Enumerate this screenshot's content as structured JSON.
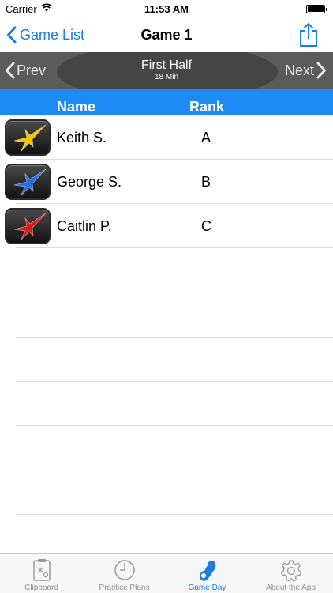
{
  "status_bar": {
    "carrier": "Carrier",
    "time": "11:53 AM"
  },
  "nav": {
    "back_label": "Game List",
    "title": "Game 1"
  },
  "period": {
    "prev_label": "Prev",
    "next_label": "Next",
    "title": "First Half",
    "duration": "18 Min"
  },
  "header": {
    "name_label": "Name",
    "rank_label": "Rank"
  },
  "players": [
    {
      "name": "Keith S.",
      "rank": "A",
      "star_color": "#f5c400"
    },
    {
      "name": "George S.",
      "rank": "B",
      "star_color": "#1e6fe8"
    },
    {
      "name": "Caitlin P.",
      "rank": "C",
      "star_color": "#e01818"
    }
  ],
  "tabs": [
    {
      "label": "Clipboard",
      "icon": "clipboard-icon",
      "active": false
    },
    {
      "label": "Practice Plans",
      "icon": "clock-icon",
      "active": false
    },
    {
      "label": "Game Day",
      "icon": "whistle-icon",
      "active": true
    },
    {
      "label": "About the App",
      "icon": "gear-icon",
      "active": false
    }
  ],
  "colors": {
    "accent": "#1a7de0",
    "header_bg": "#1e8af5",
    "period_bar_bg": "#5b5b5b"
  }
}
